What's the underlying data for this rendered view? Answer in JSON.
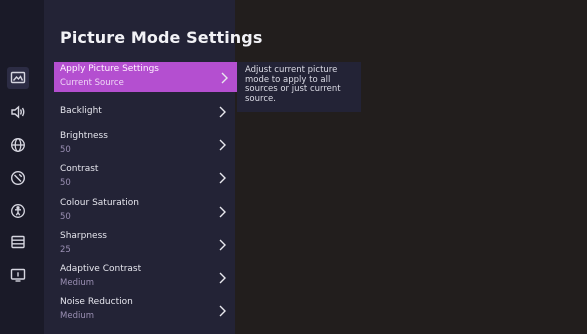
{
  "panel": {
    "title": "Picture Mode Settings"
  },
  "rail": {
    "icons": [
      "picture-icon",
      "sound-icon",
      "network-icon",
      "display-icon",
      "accessibility-icon",
      "storage-icon",
      "info-icon"
    ]
  },
  "menu": {
    "items": [
      {
        "label": "Apply Picture Settings",
        "value": "Current Source",
        "selected": true
      },
      {
        "label": "Backlight",
        "value": ""
      },
      {
        "label": "Brightness",
        "value": "50"
      },
      {
        "label": "Contrast",
        "value": "50"
      },
      {
        "label": "Colour Saturation",
        "value": "50"
      },
      {
        "label": "Sharpness",
        "value": "25"
      },
      {
        "label": "Adaptive Contrast",
        "value": "Medium"
      },
      {
        "label": "Noise Reduction",
        "value": "Medium"
      }
    ]
  },
  "tooltip": {
    "text": "Adjust current picture mode to apply to all sources or just current source."
  },
  "colors": {
    "background": "#221e1d",
    "panel": "#232336",
    "rail": "#1a1a28",
    "accent": "#b44fd0",
    "value_text": "#9a8fb3"
  }
}
